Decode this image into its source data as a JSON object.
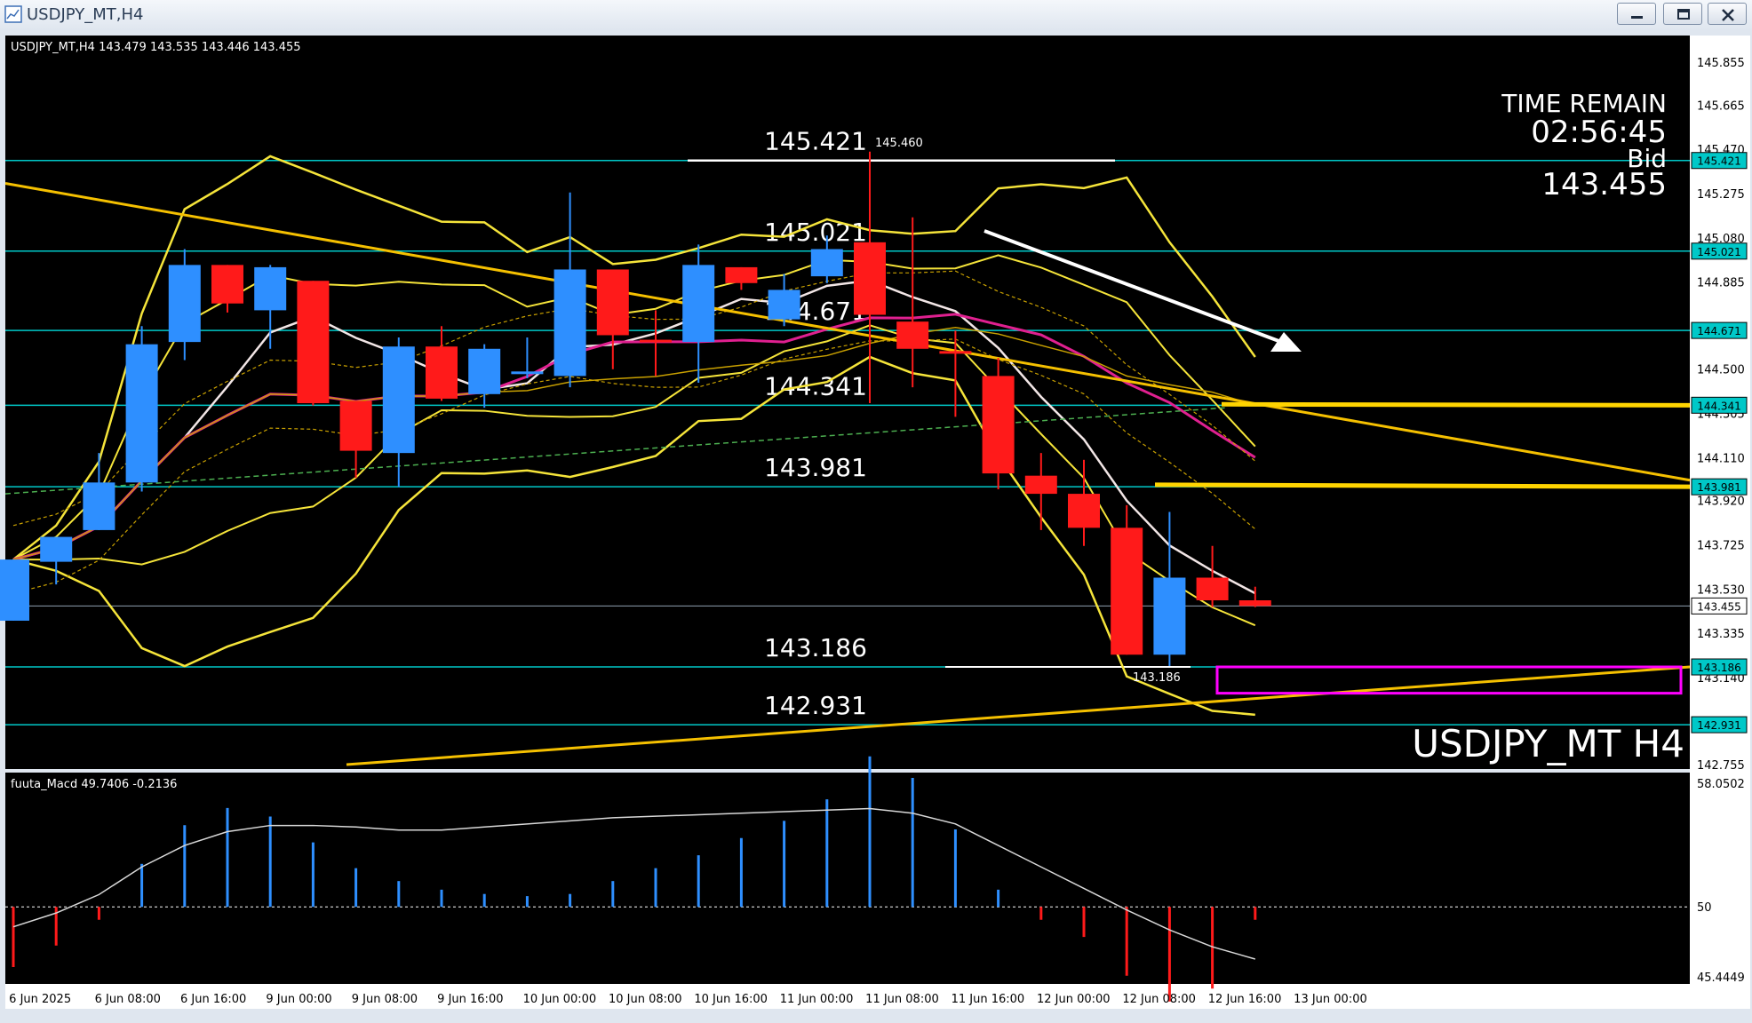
{
  "window": {
    "title": "USDJPY_MT,H4",
    "buttons": [
      "minimize",
      "restore",
      "close"
    ]
  },
  "chart": {
    "header": "USDJPY_MT,H4  143.479 143.535 143.446 143.455",
    "watermark": "USDJPY_MT H4",
    "time_remain_label": "TIME REMAIN",
    "time_remain_value": "02:56:45",
    "bid_label": "Bid",
    "bid_value": "143.455",
    "colors": {
      "background": "#000000",
      "bull": "#2e8fff",
      "bear": "#ff1a1a",
      "level_line": "#00c8c8",
      "bollinger": "#f5e43a",
      "trendline": "#f5c000",
      "ma_white": "#f2e6e6",
      "ma_magenta": "#e02090",
      "box": "#ff00ff"
    }
  },
  "chart_data": [
    {
      "type": "candlestick",
      "symbol": "USDJPY_MT",
      "timeframe": "H4",
      "x_ticks": [
        "6 Jun 2025",
        "6 Jun 08:00",
        "6 Jun 16:00",
        "9 Jun 00:00",
        "9 Jun 08:00",
        "9 Jun 16:00",
        "10 Jun 00:00",
        "10 Jun 08:00",
        "10 Jun 16:00",
        "11 Jun 00:00",
        "11 Jun 08:00",
        "11 Jun 16:00",
        "12 Jun 00:00",
        "12 Jun 08:00",
        "12 Jun 16:00",
        "13 Jun 00:00"
      ],
      "y_ticks": [
        "145.855",
        "145.665",
        "145.470",
        "145.275",
        "145.080",
        "144.885",
        "144.500",
        "144.305",
        "144.110",
        "143.920",
        "143.725",
        "143.530",
        "143.335",
        "143.140",
        "142.755"
      ],
      "ylim": [
        142.755,
        145.855
      ],
      "price_tags": [
        "145.421",
        "145.021",
        "144.671",
        "144.341",
        "143.981",
        "143.455",
        "143.186",
        "142.931"
      ],
      "horizontal_levels": [
        {
          "price": 145.421,
          "label": "145.421"
        },
        {
          "price": 145.021,
          "label": "145.021"
        },
        {
          "price": 144.671,
          "label": "144.671"
        },
        {
          "price": 144.341,
          "label": "144.341"
        },
        {
          "price": 143.981,
          "label": "143.981"
        },
        {
          "price": 143.186,
          "label": "143.186"
        },
        {
          "price": 142.931,
          "label": "142.931"
        }
      ],
      "annotations": {
        "high": "145.460",
        "low": "143.186"
      },
      "candles": [
        {
          "o": 143.39,
          "h": 143.66,
          "l": 143.39,
          "c": 143.66
        },
        {
          "o": 143.65,
          "h": 143.76,
          "l": 143.55,
          "c": 143.76
        },
        {
          "o": 143.79,
          "h": 144.13,
          "l": 143.79,
          "c": 144.0
        },
        {
          "o": 144.0,
          "h": 144.69,
          "l": 143.96,
          "c": 144.61
        },
        {
          "o": 144.62,
          "h": 145.03,
          "l": 144.54,
          "c": 144.96
        },
        {
          "o": 144.96,
          "h": 144.96,
          "l": 144.75,
          "c": 144.79
        },
        {
          "o": 144.76,
          "h": 144.96,
          "l": 144.59,
          "c": 144.95
        },
        {
          "o": 144.89,
          "h": 144.89,
          "l": 144.34,
          "c": 144.35
        },
        {
          "o": 144.36,
          "h": 144.36,
          "l": 144.02,
          "c": 144.14
        },
        {
          "o": 144.13,
          "h": 144.64,
          "l": 143.98,
          "c": 144.6
        },
        {
          "o": 144.6,
          "h": 144.69,
          "l": 144.36,
          "c": 144.37
        },
        {
          "o": 144.39,
          "h": 144.61,
          "l": 144.33,
          "c": 144.59
        },
        {
          "o": 144.48,
          "h": 144.64,
          "l": 144.46,
          "c": 144.49
        },
        {
          "o": 144.47,
          "h": 145.28,
          "l": 144.42,
          "c": 144.94
        },
        {
          "o": 144.94,
          "h": 144.94,
          "l": 144.5,
          "c": 144.65
        },
        {
          "o": 144.63,
          "h": 144.76,
          "l": 144.47,
          "c": 144.62
        },
        {
          "o": 144.62,
          "h": 145.05,
          "l": 144.44,
          "c": 144.96
        },
        {
          "o": 144.95,
          "h": 144.95,
          "l": 144.85,
          "c": 144.88
        },
        {
          "o": 144.72,
          "h": 144.92,
          "l": 144.69,
          "c": 144.85
        },
        {
          "o": 144.91,
          "h": 145.09,
          "l": 144.88,
          "c": 145.03
        },
        {
          "o": 145.06,
          "h": 145.46,
          "l": 144.35,
          "c": 144.74
        },
        {
          "o": 144.71,
          "h": 145.17,
          "l": 144.42,
          "c": 144.59
        },
        {
          "o": 144.58,
          "h": 144.67,
          "l": 144.29,
          "c": 144.57
        },
        {
          "o": 144.47,
          "h": 144.55,
          "l": 143.97,
          "c": 144.04
        },
        {
          "o": 144.03,
          "h": 144.13,
          "l": 143.79,
          "c": 143.95
        },
        {
          "o": 143.95,
          "h": 144.1,
          "l": 143.72,
          "c": 143.8
        },
        {
          "o": 143.8,
          "h": 143.9,
          "l": 143.24,
          "c": 143.24
        },
        {
          "o": 143.24,
          "h": 143.87,
          "l": 143.19,
          "c": 143.58
        },
        {
          "o": 143.58,
          "h": 143.72,
          "l": 143.45,
          "c": 143.48
        },
        {
          "o": 143.48,
          "h": 143.54,
          "l": 143.45,
          "c": 143.455
        }
      ]
    },
    {
      "type": "line",
      "name": "fuuta_Macd",
      "header": "fuuta_Macd 49.7406  -0.2136",
      "y_ticks": [
        "58.0502",
        "50",
        "45.4449"
      ],
      "ylim": [
        45.4449,
        58.0502
      ]
    }
  ]
}
